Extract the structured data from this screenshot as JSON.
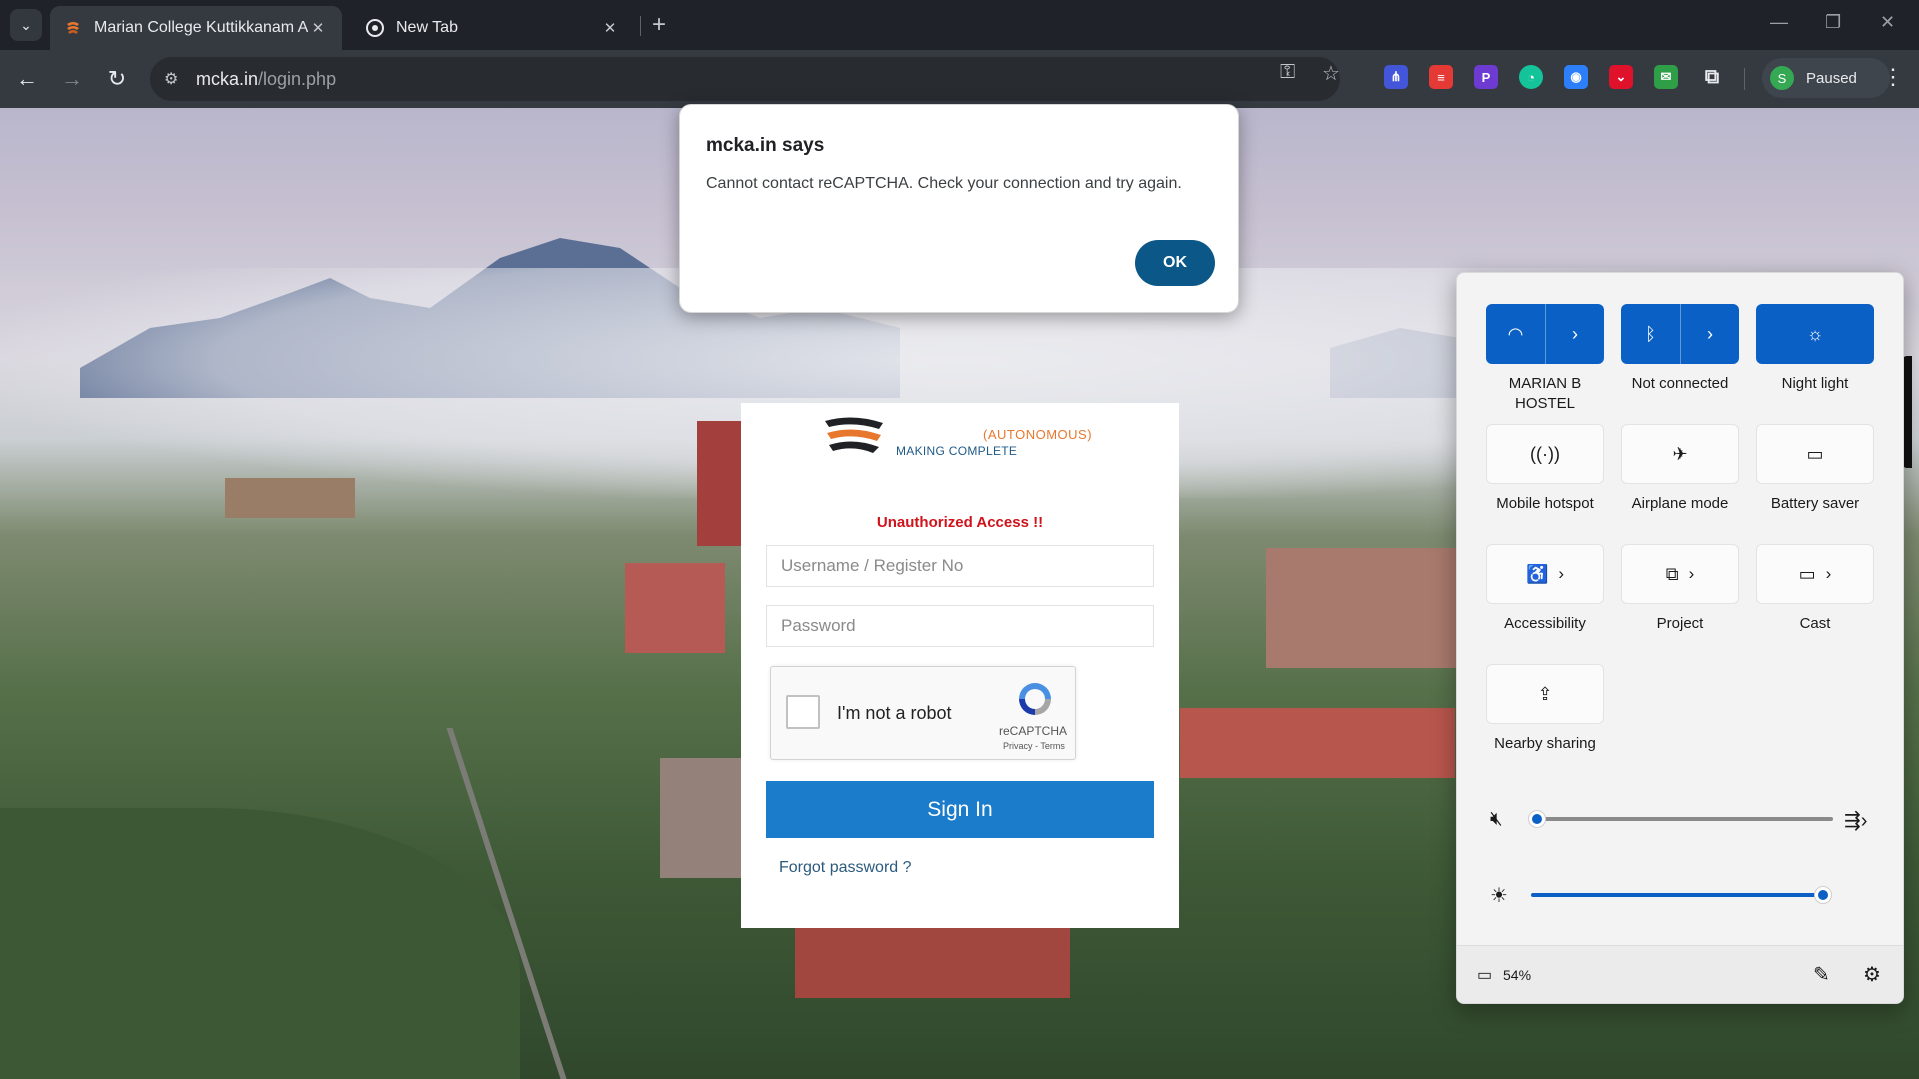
{
  "browser": {
    "tabs": [
      {
        "title": "Marian College Kuttikkanam Au",
        "active": true
      },
      {
        "title": "New Tab",
        "active": false
      }
    ],
    "url_host": "mcka.in",
    "url_path": "/login.php",
    "profile_initial": "S",
    "profile_status": "Paused",
    "extension_letters": {
      "p_ext": "P"
    }
  },
  "dialog": {
    "title": "mcka.in says",
    "message": "Cannot contact reCAPTCHA. Check your connection and try again.",
    "ok_label": "OK"
  },
  "login": {
    "logo_autonomous": "(AUTONOMOUS)",
    "logo_tagline": "MAKING COMPLETE",
    "error_message": "Unauthorized Access !!",
    "username_placeholder": "Username / Register No",
    "password_placeholder": "Password",
    "captcha_label": "I'm not a robot",
    "captcha_brand": "reCAPTCHA",
    "captcha_terms": "Privacy - Terms",
    "signin_label": "Sign In",
    "forgot_label": "Forgot password ?"
  },
  "quick_settings": {
    "tiles": {
      "wifi": {
        "label": "MARIAN B HOSTEL",
        "on": true
      },
      "bluetooth": {
        "label": "Not connected",
        "on": true
      },
      "night_light": {
        "label": "Night light",
        "on": true
      },
      "hotspot": {
        "label": "Mobile hotspot"
      },
      "airplane": {
        "label": "Airplane mode"
      },
      "battery_saver": {
        "label": "Battery saver"
      },
      "accessibility": {
        "label": "Accessibility"
      },
      "project": {
        "label": "Project"
      },
      "cast": {
        "label": "Cast"
      },
      "nearby_sharing": {
        "label": "Nearby sharing"
      }
    },
    "volume_level": 0,
    "volume_muted": true,
    "brightness_level": 1.0,
    "battery": "54%"
  },
  "colors": {
    "accent_blue": "#0b60c6",
    "signin_blue": "#1b7ccb",
    "error_red": "#d0121b",
    "dialog_ok": "#0b5787"
  }
}
